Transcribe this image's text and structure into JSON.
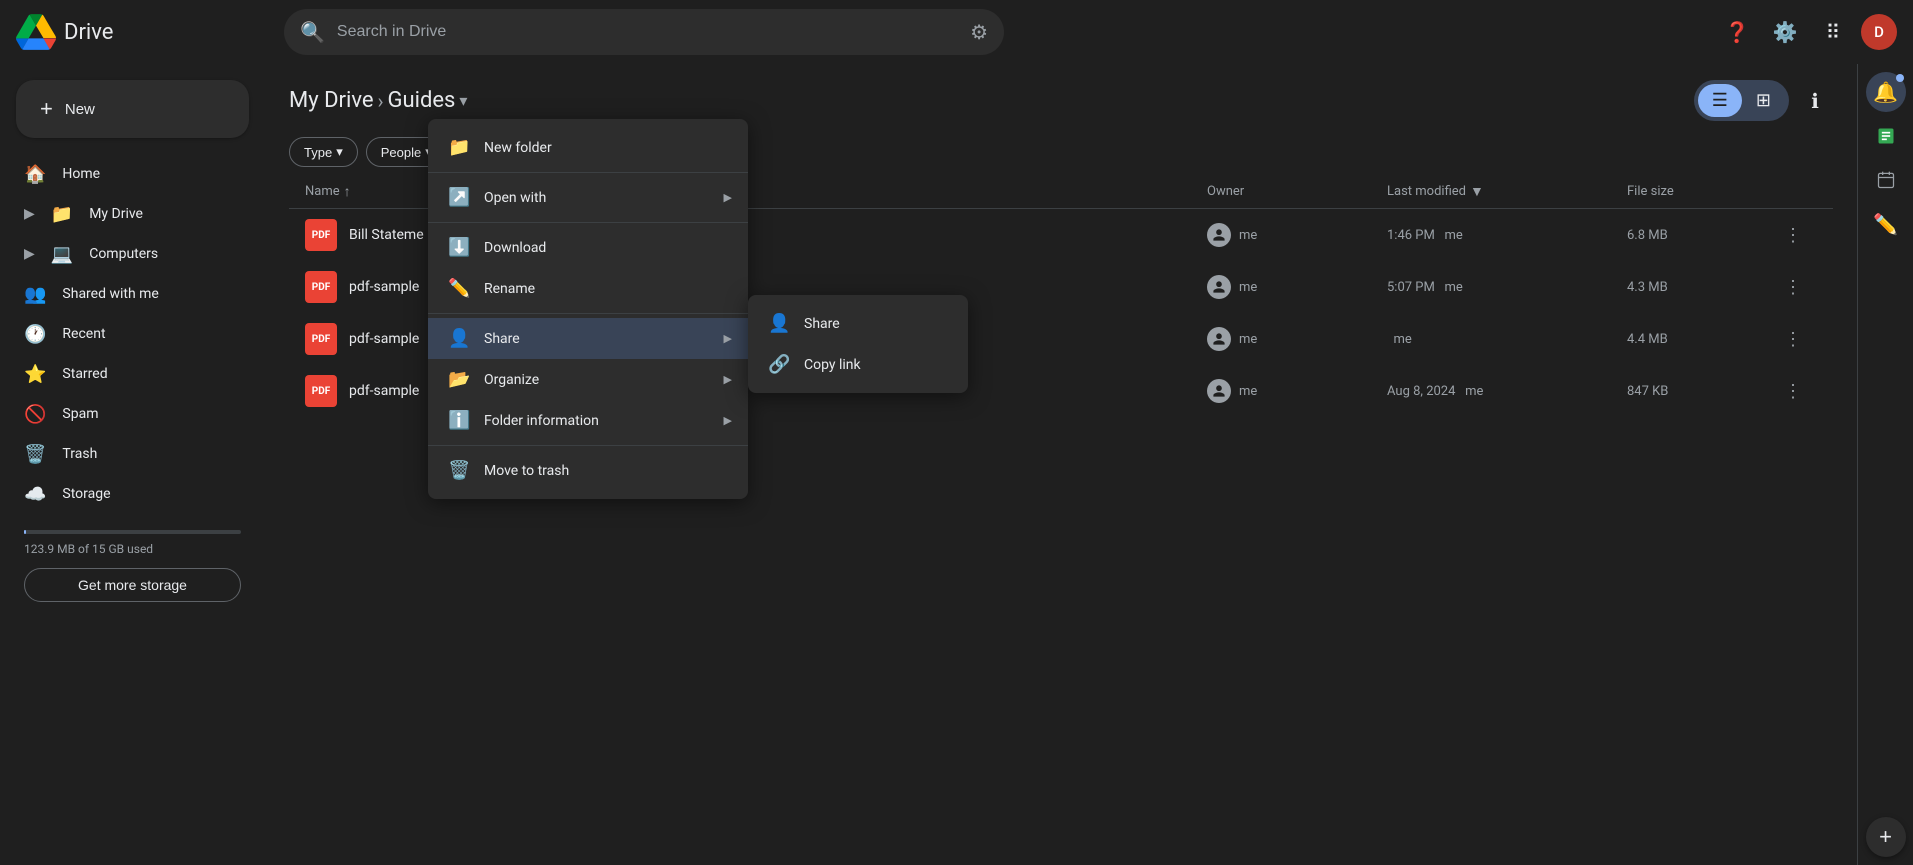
{
  "app": {
    "title": "Drive",
    "logo_alt": "Google Drive"
  },
  "topbar": {
    "search_placeholder": "Search in Drive",
    "help_tooltip": "Help",
    "settings_tooltip": "Settings",
    "apps_tooltip": "Google apps",
    "avatar_initial": "D"
  },
  "sidebar": {
    "new_button_label": "New",
    "items": [
      {
        "id": "home",
        "label": "Home",
        "icon": "🏠"
      },
      {
        "id": "my-drive",
        "label": "My Drive",
        "icon": "📁",
        "expandable": true
      },
      {
        "id": "computers",
        "label": "Computers",
        "icon": "💻",
        "expandable": true
      },
      {
        "id": "shared",
        "label": "Shared with me",
        "icon": "👥"
      },
      {
        "id": "recent",
        "label": "Recent",
        "icon": "🕐"
      },
      {
        "id": "starred",
        "label": "Starred",
        "icon": "⭐"
      },
      {
        "id": "spam",
        "label": "Spam",
        "icon": "🚫"
      },
      {
        "id": "trash",
        "label": "Trash",
        "icon": "🗑️"
      },
      {
        "id": "storage",
        "label": "Storage",
        "icon": "☁️"
      }
    ],
    "storage": {
      "used": "123.9 MB of 15 GB used",
      "get_storage_label": "Get more storage",
      "percent": 0.82
    }
  },
  "header": {
    "breadcrumb_root": "My Drive",
    "current_folder": "Guides",
    "dropdown_icon": "▾"
  },
  "filters": [
    {
      "id": "type",
      "label": "Type",
      "has_dropdown": true
    },
    {
      "id": "people",
      "label": "People",
      "has_dropdown": true
    }
  ],
  "table": {
    "columns": [
      {
        "id": "name",
        "label": "Name",
        "sortable": true
      },
      {
        "id": "owner",
        "label": "Owner"
      },
      {
        "id": "last-modified",
        "label": "Last modified",
        "sortable": true,
        "active": true
      },
      {
        "id": "file-size",
        "label": "File size"
      },
      {
        "id": "actions",
        "label": ""
      }
    ],
    "rows": [
      {
        "id": "row1",
        "name": "Bill Stateme",
        "type": "PDF",
        "owner": "me",
        "modified": "1:46 PM",
        "modified_by": "me",
        "size": "6.8 MB"
      },
      {
        "id": "row2",
        "name": "pdf-sample",
        "type": "PDF",
        "owner": "me",
        "modified": "5:07 PM",
        "modified_by": "me",
        "size": "4.3 MB"
      },
      {
        "id": "row3",
        "name": "pdf-sample",
        "type": "PDF",
        "owner": "me",
        "modified": "",
        "modified_by": "me",
        "size": "4.4 MB"
      },
      {
        "id": "row4",
        "name": "pdf-sample",
        "type": "PDF",
        "owner": "me",
        "modified": "Aug 8, 2024",
        "modified_by": "me",
        "size": "847 KB"
      }
    ]
  },
  "context_menu": {
    "items": [
      {
        "id": "new-folder",
        "label": "New folder",
        "icon": "📁",
        "has_submenu": false
      },
      {
        "id": "open-with",
        "label": "Open with",
        "icon": "↗",
        "has_submenu": true
      },
      {
        "id": "download",
        "label": "Download",
        "icon": "⬇",
        "has_submenu": false
      },
      {
        "id": "rename",
        "label": "Rename",
        "icon": "✏️",
        "has_submenu": false
      },
      {
        "id": "share",
        "label": "Share",
        "icon": "👤+",
        "has_submenu": true,
        "highlighted": true
      },
      {
        "id": "organize",
        "label": "Organize",
        "icon": "📂",
        "has_submenu": true
      },
      {
        "id": "folder-info",
        "label": "Folder information",
        "icon": "ℹ",
        "has_submenu": true
      },
      {
        "id": "move-trash",
        "label": "Move to trash",
        "icon": "🗑️",
        "has_submenu": false
      }
    ]
  },
  "submenu": {
    "items": [
      {
        "id": "share-sub",
        "label": "Share",
        "icon": "👤"
      },
      {
        "id": "copy-link",
        "label": "Copy link",
        "icon": "🔗"
      }
    ]
  },
  "right_panel": {
    "icons": [
      {
        "id": "notifications",
        "label": "Notifications",
        "icon": "🔔",
        "has_badge": true
      },
      {
        "id": "sheets",
        "label": "Google Sheets",
        "icon": "📊"
      },
      {
        "id": "calendar",
        "label": "Calendar",
        "icon": "📅"
      },
      {
        "id": "edit",
        "label": "Edit",
        "icon": "✏️",
        "active": true
      }
    ],
    "add_icon": "+"
  }
}
